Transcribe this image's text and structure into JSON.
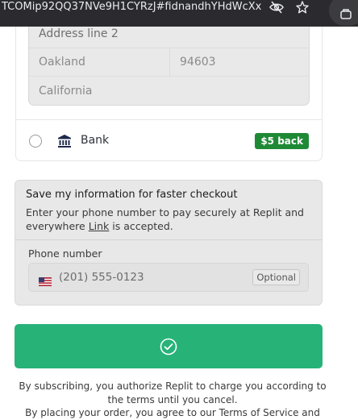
{
  "browser": {
    "url": "TCOMip92QQ37NVe9H1CYRzJ#fidnandhYHdWcXx..."
  },
  "address": {
    "line2_placeholder": "Address line 2",
    "city": "Oakland",
    "zip": "94603",
    "state": "California"
  },
  "payment_methods": {
    "bank": {
      "label": "Bank",
      "badge": "$5 back",
      "badge_color": "#1f8a36"
    }
  },
  "save_info": {
    "title": "Save my information for faster checkout",
    "description_before_link": "Enter your phone number to pay securely at Replit and everywhere ",
    "link_text": "Link",
    "description_after_link": " is accepted.",
    "phone_label": "Phone number",
    "phone_placeholder": "(201) 555-0123",
    "optional_label": "Optional"
  },
  "submit": {
    "color": "#27b278",
    "icon": "checkmark-circle-icon"
  },
  "terms": {
    "line1": "By subscribing, you authorize Replit to charge you according to the terms until you cancel.",
    "line2": "By placing your order, you agree to our Terms of Service and"
  }
}
